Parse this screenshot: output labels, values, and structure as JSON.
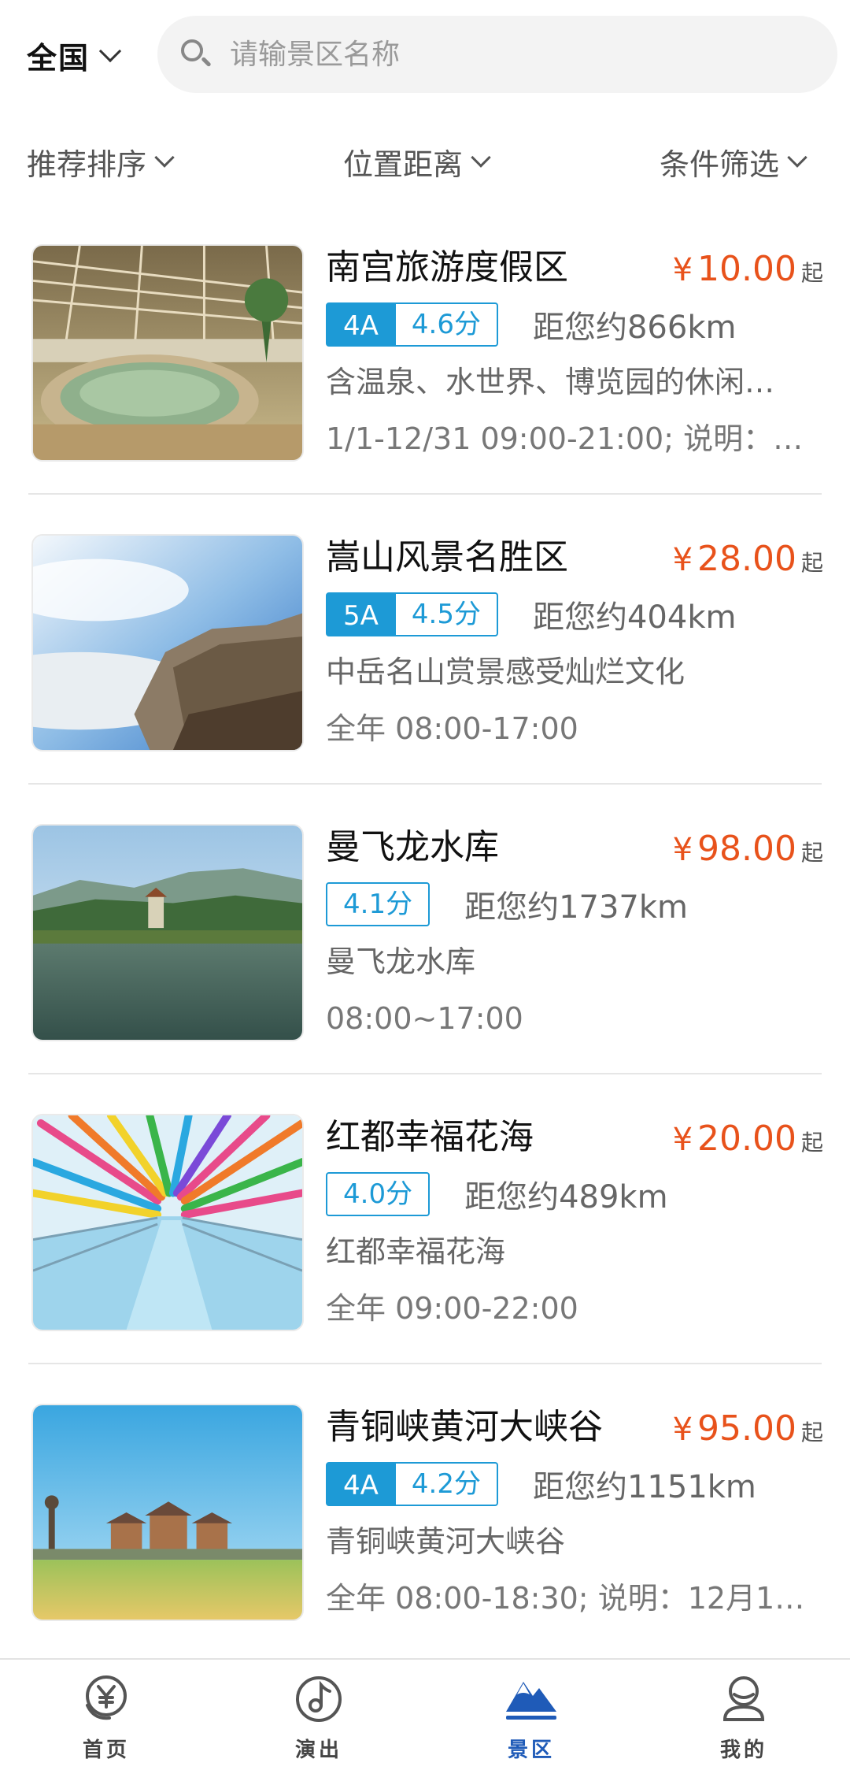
{
  "header": {
    "region": "全国",
    "search_placeholder": "请输景区名称"
  },
  "filters": [
    {
      "label": "推荐排序"
    },
    {
      "label": "位置距离"
    },
    {
      "label": "条件筛选"
    }
  ],
  "items": [
    {
      "name": "南宫旅游度假区",
      "price_symbol": "¥",
      "price": "10.00",
      "price_suffix": "起",
      "grade": "4A",
      "score": "4.6分",
      "distance": "距您约866km",
      "desc": "含温泉、水世界、博览园的休闲…",
      "hours": "1/1-12/31 09:00-21:00; 说明：…"
    },
    {
      "name": "嵩山风景名胜区",
      "price_symbol": "¥",
      "price": "28.00",
      "price_suffix": "起",
      "grade": "5A",
      "score": "4.5分",
      "distance": "距您约404km",
      "desc": "中岳名山赏景感受灿烂文化",
      "hours": "全年 08:00-17:00"
    },
    {
      "name": "曼飞龙水库",
      "price_symbol": "¥",
      "price": "98.00",
      "price_suffix": "起",
      "grade": "",
      "score": "4.1分",
      "distance": "距您约1737km",
      "desc": "曼飞龙水库",
      "hours": "08:00~17:00"
    },
    {
      "name": "红都幸福花海",
      "price_symbol": "¥",
      "price": "20.00",
      "price_suffix": "起",
      "grade": "",
      "score": "4.0分",
      "distance": "距您约489km",
      "desc": "红都幸福花海",
      "hours": "全年 09:00-22:00"
    },
    {
      "name": "青铜峡黄河大峡谷",
      "price_symbol": "¥",
      "price": "95.00",
      "price_suffix": "起",
      "grade": "4A",
      "score": "4.2分",
      "distance": "距您约1151km",
      "desc": "青铜峡黄河大峡谷",
      "hours": "全年 08:00-18:30; 说明：12月1…"
    }
  ],
  "bottom_nav": [
    {
      "label": "首页",
      "icon": "yen-coin-icon",
      "active": false
    },
    {
      "label": "演出",
      "icon": "music-note-icon",
      "active": false
    },
    {
      "label": "景区",
      "icon": "mountain-icon",
      "active": true
    },
    {
      "label": "我的",
      "icon": "profile-icon",
      "active": false
    }
  ],
  "colors": {
    "accent_blue": "#1d9ad6",
    "price_orange": "#e8521b",
    "active_tab": "#1f5bb8"
  }
}
